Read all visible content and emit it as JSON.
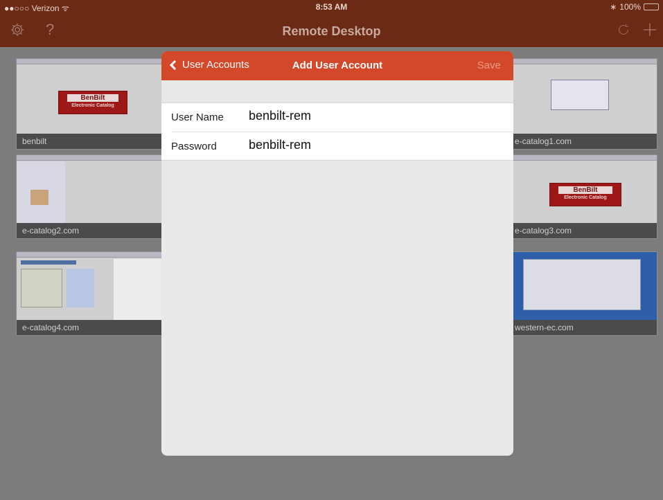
{
  "status_bar": {
    "carrier": "●●○○○ Verizon ᯤ",
    "time": "8:53 AM",
    "battery": "100%",
    "bluetooth": "∗"
  },
  "nav": {
    "title": "Remote Desktop",
    "left_icons": [
      "gear-icon",
      "help-icon"
    ],
    "right_icons": [
      "refresh-icon",
      "add-icon"
    ]
  },
  "tiles": [
    {
      "label": "benbilt"
    },
    {
      "label": "e-catalog1.com"
    },
    {
      "label": "e-catalog2.com"
    },
    {
      "label": "e-catalog3.com"
    },
    {
      "label": "e-catalog4.com"
    },
    {
      "label": "western-ec.com"
    }
  ],
  "logo": {
    "name": "BenBilt",
    "sub": "Electronic Catalog"
  },
  "modal": {
    "back_label": "User Accounts",
    "title": "Add User Account",
    "save_label": "Save",
    "fields": [
      {
        "label": "User Name",
        "value": "benbilt-rem"
      },
      {
        "label": "Password",
        "value": "benbilt-rem"
      }
    ]
  },
  "colors": {
    "nav_dark": "#6b2a14",
    "modal_accent": "#d4482a",
    "overlay": "#7c7c7c"
  }
}
